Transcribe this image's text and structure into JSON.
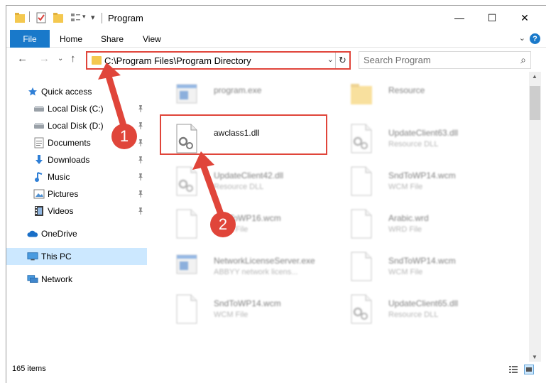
{
  "window": {
    "title": "Program",
    "minimize_glyph": "—",
    "maximize_glyph": "☐",
    "close_glyph": "✕"
  },
  "ribbon": {
    "tabs": [
      "File",
      "Home",
      "Share",
      "View"
    ],
    "help_glyph": "?"
  },
  "address": {
    "path": "C:\\Program Files\\Program Directory",
    "refresh_glyph": "↻",
    "dropdown_glyph": "⌄"
  },
  "search": {
    "placeholder": "Search Program"
  },
  "nav": {
    "items": [
      {
        "label": "Quick access",
        "icon": "star-icon",
        "pinned": false
      },
      {
        "label": "Local Disk (C:)",
        "icon": "drive-icon",
        "pinned": true
      },
      {
        "label": "Local Disk (D:)",
        "icon": "drive-icon",
        "pinned": true
      },
      {
        "label": "Documents",
        "icon": "documents-icon",
        "pinned": true
      },
      {
        "label": "Downloads",
        "icon": "download-icon",
        "pinned": true
      },
      {
        "label": "Music",
        "icon": "music-icon",
        "pinned": true
      },
      {
        "label": "Pictures",
        "icon": "pictures-icon",
        "pinned": true
      },
      {
        "label": "Videos",
        "icon": "videos-icon",
        "pinned": true
      },
      {
        "label": "OneDrive",
        "icon": "cloud-icon",
        "pinned": false
      },
      {
        "label": "This PC",
        "icon": "computer-icon",
        "pinned": false,
        "selected": true
      },
      {
        "label": "Network",
        "icon": "network-icon",
        "pinned": false
      }
    ]
  },
  "files": [
    {
      "name": "program.exe",
      "sub": "",
      "icon": "exe-icon"
    },
    {
      "name": "Resource",
      "sub": "",
      "icon": "folder-icon"
    },
    {
      "name": "awclass1.dll",
      "sub": "",
      "icon": "dll-icon",
      "highlighted": true
    },
    {
      "name": "UpdateClient63.dll",
      "sub": "Resource DLL",
      "icon": "dll-icon"
    },
    {
      "name": "UpdateClient42.dll",
      "sub": "Resource DLL",
      "icon": "dll-icon"
    },
    {
      "name": "SndToWP14.wcm",
      "sub": "WCM File",
      "icon": "file-icon"
    },
    {
      "name": "SndToWP16.wcm",
      "sub": "WCM File",
      "icon": "file-icon"
    },
    {
      "name": "Arabic.wrd",
      "sub": "WRD File",
      "icon": "file-icon"
    },
    {
      "name": "NetworkLicenseServer.exe",
      "sub": "ABBYY network licens...",
      "icon": "exe-icon"
    },
    {
      "name": "SndToWP14.wcm",
      "sub": "WCM File",
      "icon": "file-icon"
    },
    {
      "name": "SndToWP14.wcm",
      "sub": "WCM File",
      "icon": "file-icon"
    },
    {
      "name": "UpdateClient65.dll",
      "sub": "Resource DLL",
      "icon": "dll-icon"
    }
  ],
  "status": {
    "item_count": "165 items"
  },
  "annotations": {
    "step1": "1",
    "step2": "2",
    "color": "#e0453a"
  },
  "colors": {
    "accent": "#1979ca",
    "selection": "#cce8ff",
    "highlight": "#e0453a"
  }
}
